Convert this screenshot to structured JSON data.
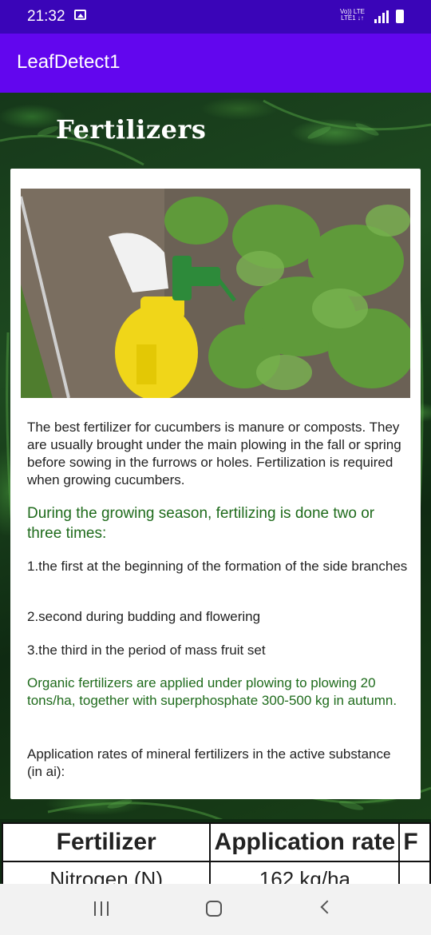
{
  "status_bar": {
    "time": "21:32",
    "network_top": "Vo)) LTE",
    "network_bottom": "LTE1 ↓↑"
  },
  "app_bar": {
    "title": "LeafDetect1",
    "color": "#6206ee"
  },
  "page": {
    "heading": "Fertilizers",
    "paragraphs": {
      "p1": "The best fertilizer for cucumbers is manure or composts. They are usually brought under the main plowing in the fall or spring before sowing in the furrows or holes. Fertilization is required when growing cucumbers.",
      "p2": "During the growing season, fertilizing is done two or three times:",
      "p3": "1.the first at the beginning of the formation of the side branches",
      "p4": "2.second during budding and flowering",
      "p5": "3.the third in the period of mass fruit set",
      "p6": "Organic fertilizers are applied under plowing to plowing 20 tons/ha, together with superphosphate 300-500 kg in autumn.",
      "p7": "Application rates of mineral fertilizers in the active substance (in ai):"
    },
    "accent_green": "#1f6b1c"
  },
  "table": {
    "headers": [
      "Fertilizer",
      "Application rate",
      "F"
    ],
    "rows": [
      [
        "Nitrogen (N)",
        "162 kg/ha",
        ""
      ]
    ]
  },
  "nav_bar": {
    "icons": [
      "recent-apps-icon",
      "home-icon",
      "back-icon"
    ]
  }
}
